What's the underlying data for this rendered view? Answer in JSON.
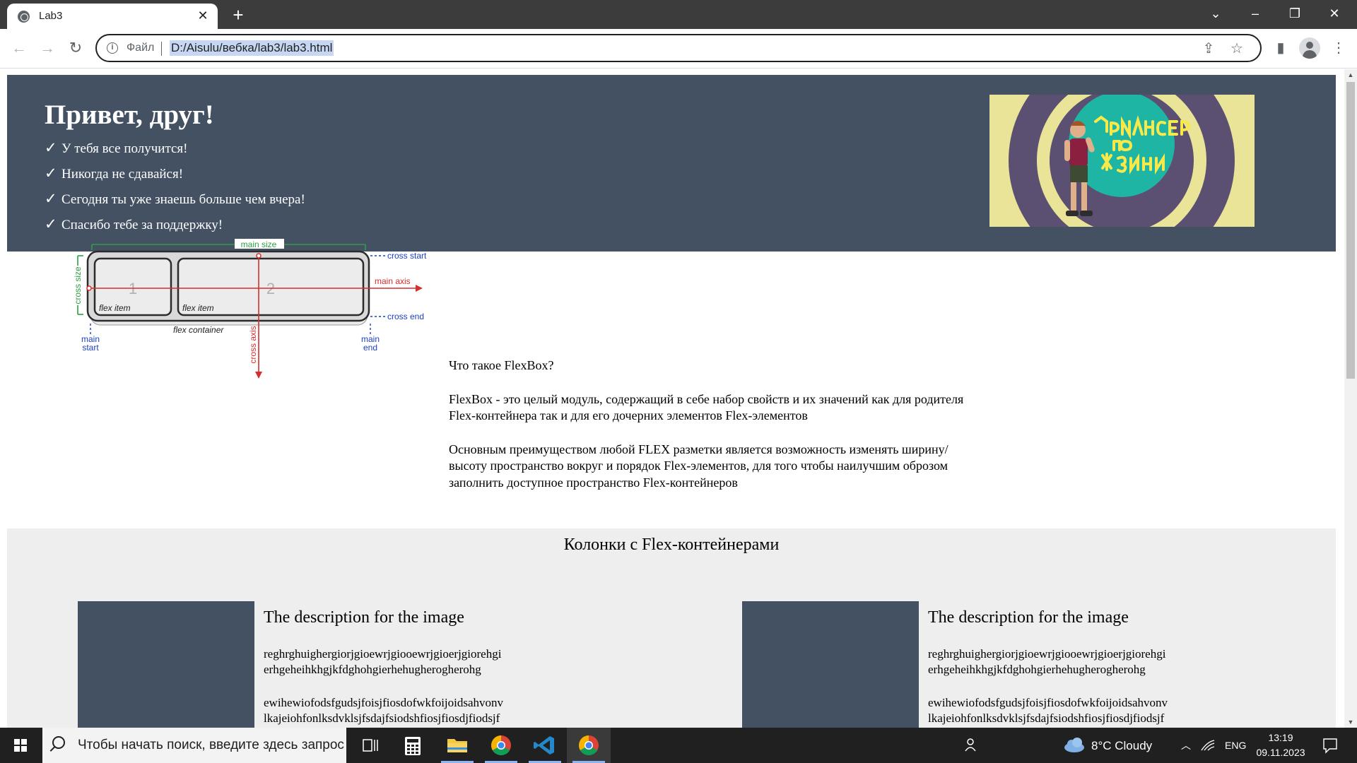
{
  "browser": {
    "tab_title": "Lab3",
    "scheme_label": "Файл",
    "url": "D:/Aisulu/вебка/lab3/lab3.html",
    "icons": [
      "back-icon",
      "forward-icon",
      "reload-icon",
      "info-icon",
      "share-icon",
      "star-icon",
      "side-panel-icon",
      "profile-icon",
      "menu-icon"
    ]
  },
  "hero": {
    "title": "Привет, друг!",
    "items": [
      "У тебя все получится!",
      "Никогда не сдавайся!",
      "Сегодня ты уже знаешь больше чем вчера!",
      "Спасибо тебе за поддержку!"
    ],
    "banner_text": "Фрилансер по жизни",
    "colors": {
      "hero_bg": "#445163",
      "banner_yellow": "#e9e497",
      "banner_purple": "#5b4f72",
      "banner_teal": "#1fb5a5"
    }
  },
  "diagram": {
    "main_size": "main size",
    "cross_start": "cross start",
    "cross_end": "cross end",
    "main_axis": "main axis",
    "cross_size": "cross size",
    "cross_axis": "cross axis",
    "flex_container": "flex container",
    "item1_number": "1",
    "item2_number": "2",
    "flex_item": "flex item",
    "main_start_1": "main",
    "main_start_2": "start",
    "main_end_1": "main",
    "main_end_2": "end"
  },
  "flexbox": {
    "heading": "Что такое FlexBox?",
    "p1": "FlexBox - это целый модуль, содержащий в себе набор свойств и их значений как для родителя Flex-контейнера так и для его дочерних элементов Flex-элементов",
    "p2": "Основным преимуществом любой FLEX разметки является возможность изменять ширину/высоту пространство вокруг и порядок Flex-элементов, для того чтобы наилучшим оброзом заполнить доступное пространство Flex-контейнеров"
  },
  "columns": {
    "title": "Колонки с Flex-контейнерами",
    "cards": [
      {
        "heading": "The description for the image",
        "text1": "reghrghuighergiorjgioewrjgiooewrjgioerjgiorehgi erhgeheihkhgjkfdghohgierhehugherogherohg",
        "text2": "ewihewiofodsfgudsjfoisjfiosdofwkfoijoidsahvonv lkajeiohfonlksdvklsjfsdajfsiodshfiosjfiosdjfiodsjf"
      },
      {
        "heading": "The description for the image",
        "text1": "reghrghuighergiorjgioewrjgiooewrjgioerjgiorehgi erhgeheihkhgjkfdghohgierhehugherogherohg",
        "text2": "ewihewiofodsfgudsjfoisjfiosdofwkfoijoidsahvonv lkajeiohfonlksdvklsjfsdajfsiodshfiosjfiosdjfiodsjf"
      }
    ]
  },
  "taskbar": {
    "search_placeholder": "Чтобы начать поиск, введите здесь запрос",
    "weather": "8°C  Cloudy",
    "lang": "ENG",
    "time": "13:19",
    "date": "09.11.2023"
  }
}
